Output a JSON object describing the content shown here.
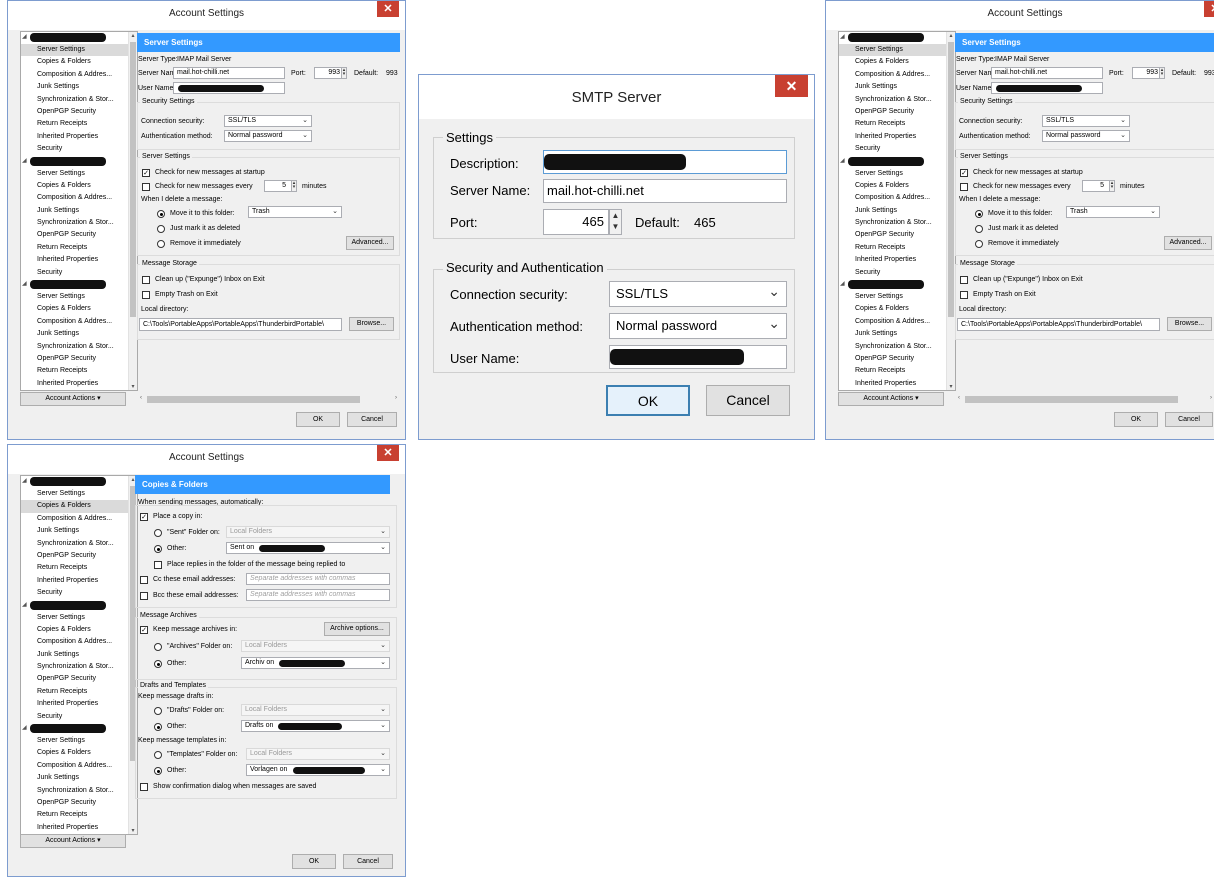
{
  "tree": {
    "account_items": [
      "Server Settings",
      "Copies & Folders",
      "Composition & Addres...",
      "Junk Settings",
      "Synchronization & Stor...",
      "OpenPGP Security",
      "Return Receipts",
      "Inherited Properties",
      "Security"
    ],
    "account_actions": "Account Actions"
  },
  "dialog_buttons": {
    "ok": "OK",
    "cancel": "Cancel"
  },
  "server_settings": {
    "window_title": "Account Settings",
    "header": "Server Settings",
    "server_type_label": "Server Type:",
    "server_type_value": "IMAP Mail Server",
    "server_name_label": "Server Name:",
    "server_name_value": "mail.hot-chilli.net",
    "port_label": "Port:",
    "port_value": "993",
    "default_label": "Default:",
    "default_value": "993",
    "user_name_label": "User Name:",
    "security_group": "Security Settings",
    "connection_security_label": "Connection security:",
    "connection_security_value": "SSL/TLS",
    "auth_method_label": "Authentication method:",
    "auth_method_value": "Normal password",
    "server_group": "Server Settings",
    "check_startup": "Check for new messages at startup",
    "check_every": "Check for new messages every",
    "minutes_value": "5",
    "minutes_label": "minutes",
    "when_delete": "When I delete a message:",
    "move_to_folder": "Move it to this folder:",
    "folder_value": "Trash",
    "just_mark": "Just mark it as deleted",
    "remove_immediately": "Remove it immediately",
    "advanced_button": "Advanced...",
    "storage_group": "Message Storage",
    "clean_up": "Clean up (\"Expunge\") Inbox on Exit",
    "empty_trash": "Empty Trash on Exit",
    "local_directory_label": "Local directory:",
    "local_directory_value": "C:\\Tools\\PortableApps\\PortableApps\\ThunderbirdPortable\\",
    "browse_button": "Browse..."
  },
  "smtp": {
    "window_title": "SMTP Server",
    "settings_group": "Settings",
    "description_label": "Description:",
    "server_name_label": "Server Name:",
    "server_name_value": "mail.hot-chilli.net",
    "port_label": "Port:",
    "port_value": "465",
    "default_label": "Default:",
    "default_value": "465",
    "security_group": "Security and Authentication",
    "connection_security_label": "Connection security:",
    "connection_security_value": "SSL/TLS",
    "auth_method_label": "Authentication method:",
    "auth_method_value": "Normal password",
    "user_name_label": "User Name:",
    "ok": "OK",
    "cancel": "Cancel"
  },
  "copies": {
    "window_title": "Account Settings",
    "header": "Copies & Folders",
    "when_sending": "When sending messages, automatically:",
    "place_copy": "Place a copy in:",
    "sent_folder_on": "\"Sent\" Folder on:",
    "local_folders": "Local Folders",
    "other": "Other:",
    "sent_on": "Sent on",
    "place_replies": "Place replies in the folder of the message being replied to",
    "cc_label": "Cc these email addresses:",
    "bcc_label": "Bcc these email addresses:",
    "separate_placeholder": "Separate addresses with commas",
    "archives_group": "Message Archives",
    "keep_archives": "Keep message archives in:",
    "archive_options": "Archive options...",
    "archives_folder_on": "\"Archives\" Folder on:",
    "archiv_on": "Archiv on",
    "drafts_group": "Drafts and Templates",
    "keep_drafts": "Keep message drafts in:",
    "drafts_folder_on": "\"Drafts\" Folder on:",
    "drafts_on": "Drafts on",
    "keep_templates": "Keep message templates in:",
    "templates_folder_on": "\"Templates\" Folder on:",
    "vorlagen_on": "Vorlagen on",
    "show_confirmation": "Show confirmation dialog when messages are saved"
  }
}
